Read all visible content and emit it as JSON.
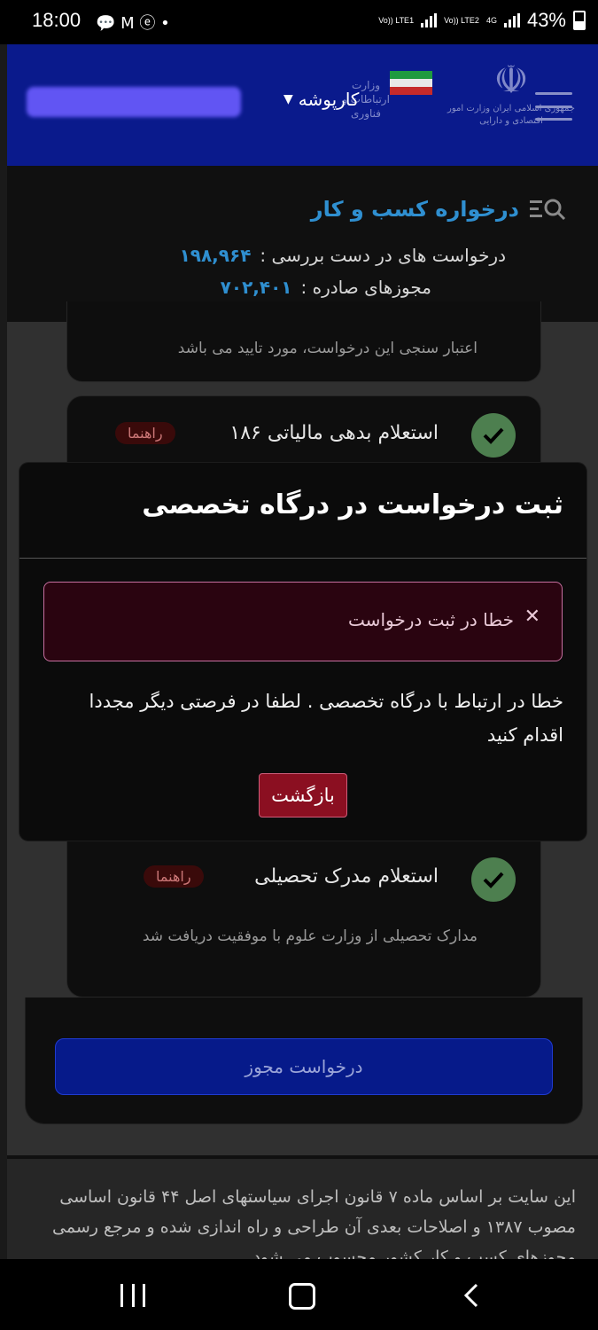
{
  "status_bar": {
    "time": "18:00",
    "notif_icons": "💬 M ⓔ •",
    "sim1": "Vo)) LTE1",
    "sim2": "Vo)) LTE2",
    "net": "4G",
    "battery": "43%"
  },
  "header": {
    "menu_label": "کارپوشه",
    "emblem_text": "جمهوری اسلامی ایران وزارت امور اقتصادی و دارایی",
    "ministry_text": "وزارت ارتباطات و فناوری"
  },
  "page": {
    "title": "درخواره کسب و کار",
    "stats": [
      {
        "label": "درخواست های در دست بررسی :",
        "value": "۱۹۸,۹۶۴"
      },
      {
        "label": "مجوزهای صادره :",
        "value": "۷۰۲,۴۰۱"
      }
    ],
    "card_validation_desc": "اعتبار سنجی این درخواست، مورد تایید می باشد",
    "card_tax": {
      "title": "استعلام بدهی مالیاتی ۱۸۶",
      "guide": "راهنما"
    },
    "card_education": {
      "title": "استعلام مدرک تحصیلی",
      "guide": "راهنما",
      "desc": "مدارک تحصیلی از وزارت علوم با موفقیت دریافت شد"
    },
    "apply_button": "درخواست مجوز"
  },
  "modal": {
    "title": "ثبت درخواست در درگاه تخصصی",
    "alert_text": "خطا در ثبت درخواست",
    "message": "خطا در ارتباط با درگاه تخصصی . لطفا در فرصتی دیگر مجددا اقدام کنید",
    "back_button": "بازگشت"
  },
  "footer": {
    "text": "این سایت بر اساس ماده ۷ قانون اجرای سیاستهای اصل ۴۴ قانون اساسی مصوب ۱۳۸۷ و اصلاحات بعدی آن طراحی و راه اندازی شده و مرجع رسمی مجوزهای کسب و کار کشور محسوب می شود"
  },
  "colors": {
    "header_bg": "#0a1a8c",
    "accent_blue": "#2f8fd0",
    "danger": "#8b0f21",
    "success": "#4d7f4f"
  }
}
